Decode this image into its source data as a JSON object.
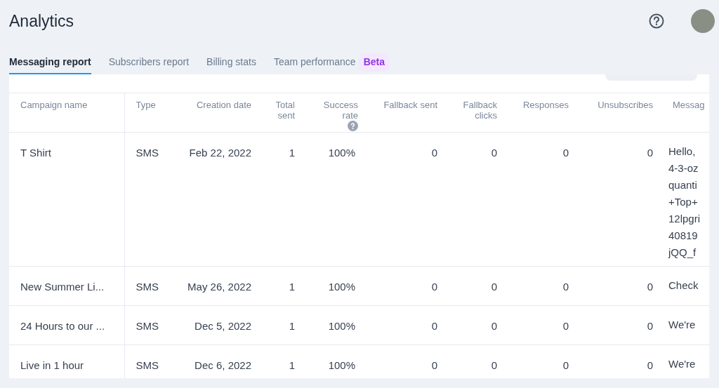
{
  "header": {
    "title": "Analytics"
  },
  "tabs": [
    {
      "label": "Messaging report",
      "selected": true
    },
    {
      "label": "Subscribers report",
      "selected": false
    },
    {
      "label": "Billing stats",
      "selected": false
    },
    {
      "label": "Team performance",
      "selected": false,
      "badge": "Beta"
    }
  ],
  "table": {
    "columns": [
      {
        "label": "Campaign name",
        "help": false
      },
      {
        "label": "Type",
        "help": false
      },
      {
        "label": "Creation date",
        "help": false
      },
      {
        "label": "Total sent",
        "help": false
      },
      {
        "label": "Success rate",
        "help": true
      },
      {
        "label": "Fallback sent",
        "help": false
      },
      {
        "label": "Fallback clicks",
        "help": false
      },
      {
        "label": "Responses",
        "help": false
      },
      {
        "label": "Unsubscribes",
        "help": false
      },
      {
        "label": "Messag",
        "help": false
      }
    ],
    "rows": [
      {
        "cells": [
          "T Shirt",
          "SMS",
          "Feb 22, 2022",
          "1",
          "100%",
          "0",
          "0",
          "0",
          "0"
        ],
        "message": [
          "Hello,",
          "4-3-oz",
          "quanti",
          "+Top+",
          "12lpgri",
          "40819",
          "jQQ_f"
        ]
      },
      {
        "cells": [
          "New Summer Li...",
          "SMS",
          "May 26, 2022",
          "1",
          "100%",
          "0",
          "0",
          "0",
          "0"
        ],
        "message": [
          "Check"
        ]
      },
      {
        "cells": [
          "24 Hours to our ...",
          "SMS",
          "Dec 5, 2022",
          "1",
          "100%",
          "0",
          "0",
          "0",
          "0"
        ],
        "message": [
          "We're"
        ]
      },
      {
        "cells": [
          "Live in 1 hour",
          "SMS",
          "Dec 6, 2022",
          "1",
          "100%",
          "0",
          "0",
          "0",
          "0"
        ],
        "message": [
          "We're"
        ]
      }
    ]
  }
}
